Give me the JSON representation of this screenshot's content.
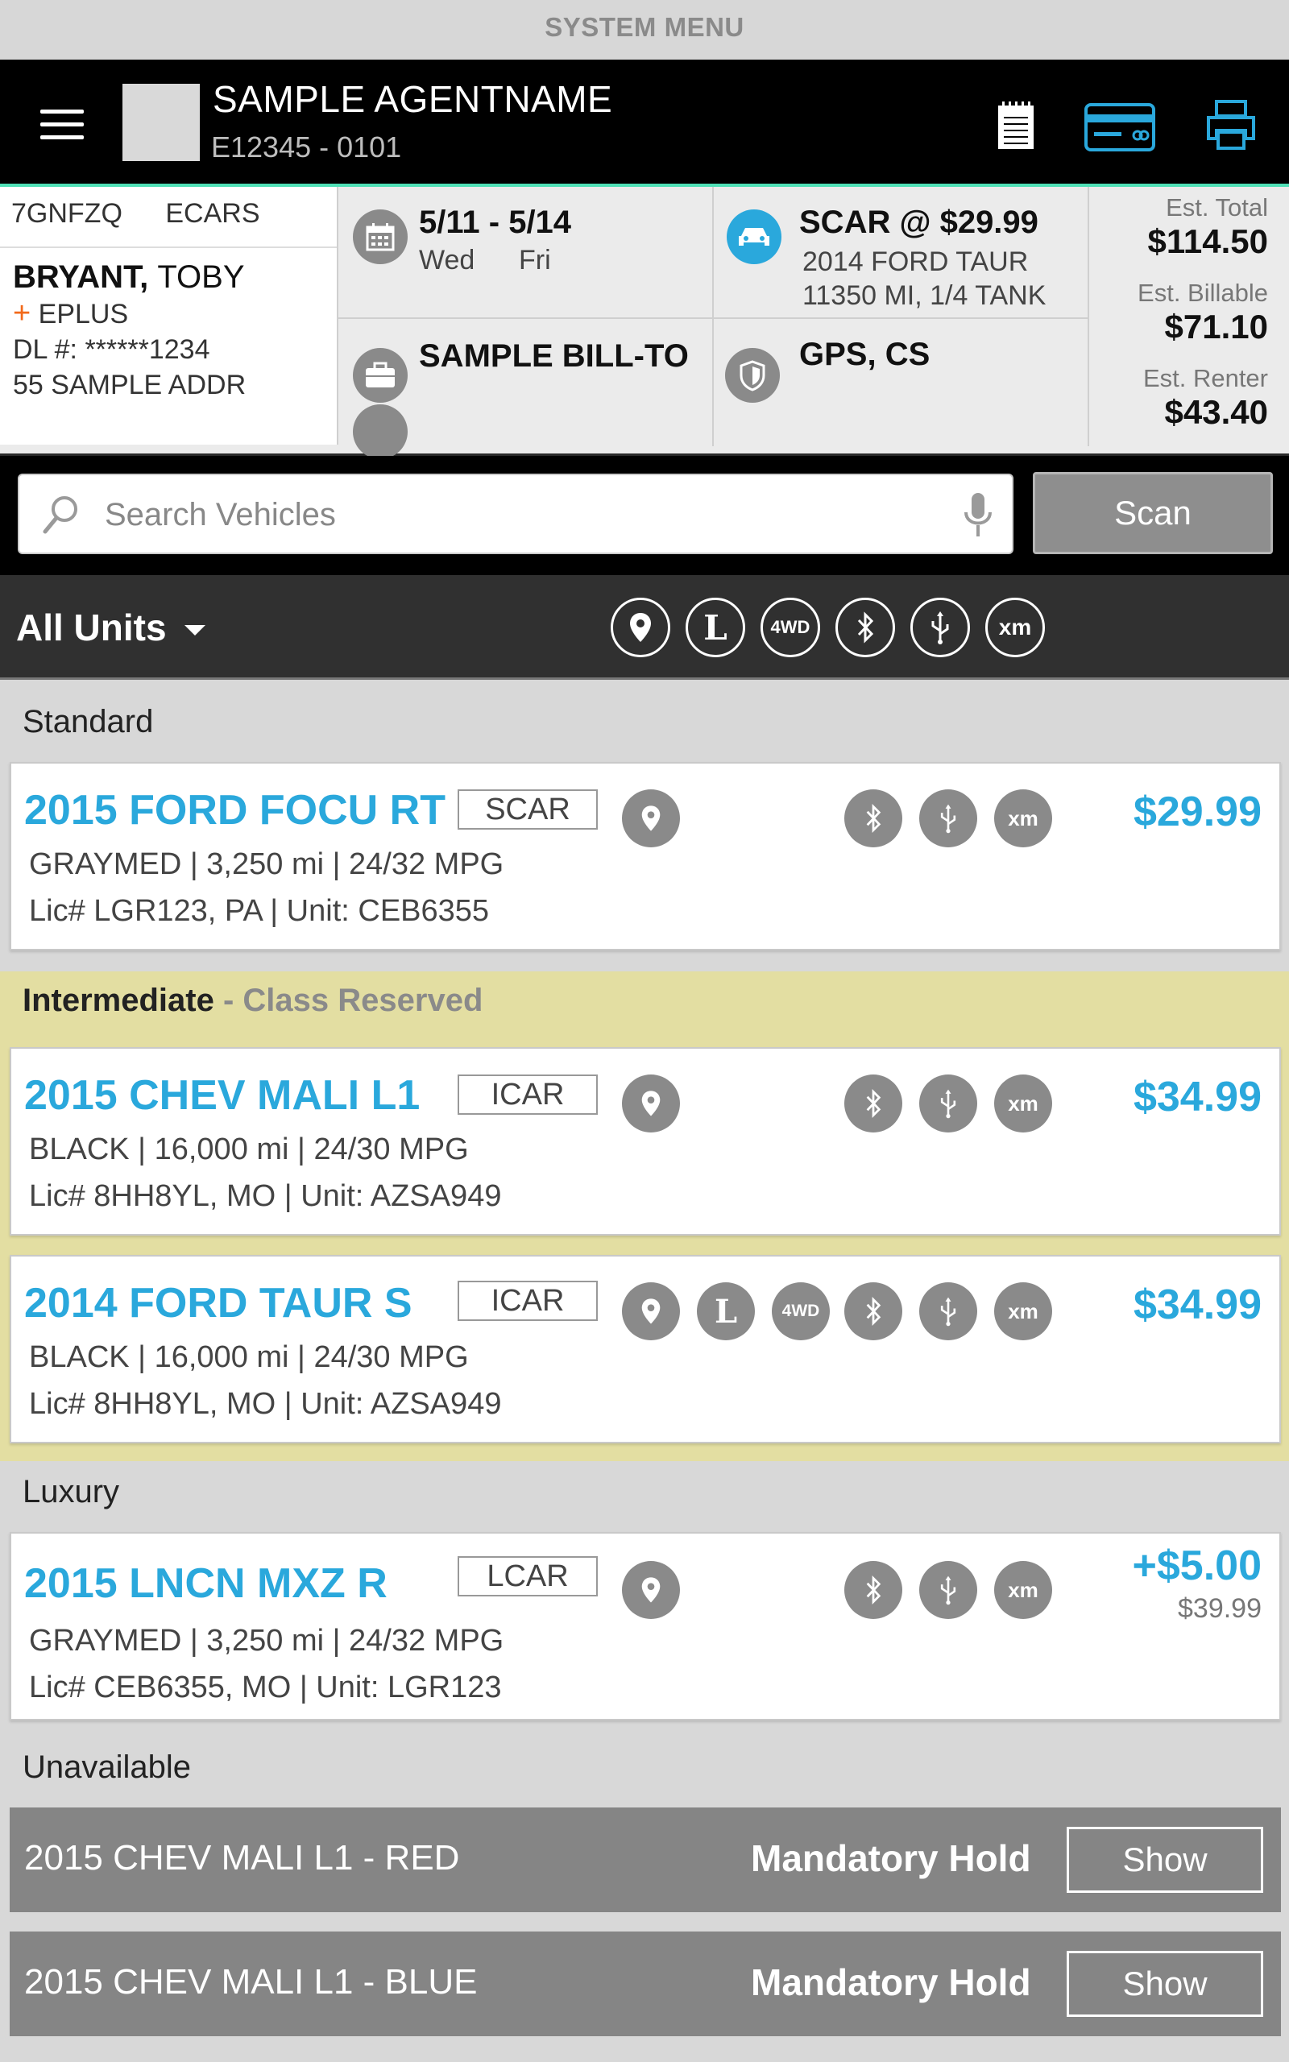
{
  "system_menu": "SYSTEM MENU",
  "agent": {
    "name": "SAMPLE AGENTNAME",
    "id": "E12345 - 0101"
  },
  "header_icons": [
    "notepad-icon",
    "credit-card-icon",
    "printer-icon"
  ],
  "customer": {
    "confirmation": "7GNFZQ",
    "source": "ECARS",
    "last_name": "BRYANT,",
    "first_name": "TOBY",
    "program_plus": "+",
    "program": "EPLUS",
    "dl": "DL #: ******1234",
    "address": "55 SAMPLE ADDR"
  },
  "reservation": {
    "dates": "5/11 - 5/14",
    "day_start": "Wed",
    "day_end": "Fri",
    "bill_to": "SAMPLE BILL-TO",
    "rate": "SCAR @ $29.99",
    "vehicle": "2014 FORD TAUR",
    "vehicle_status": "11350 MI, 1/4 TANK",
    "protections": "GPS, CS"
  },
  "totals": {
    "total_label": "Est. Total",
    "total_value": "$114.50",
    "billable_label": "Est. Billable",
    "billable_value": "$71.10",
    "renter_label": "Est. Renter",
    "renter_value": "$43.40"
  },
  "search": {
    "placeholder": "Search Vehicles",
    "scan_label": "Scan"
  },
  "filter": {
    "label": "All Units",
    "chips": [
      "location-pin-icon",
      "L",
      "4WD",
      "bluetooth-icon",
      "usb-icon",
      "xm"
    ]
  },
  "sections": {
    "standard": "Standard",
    "intermediate": "Intermediate",
    "intermediate_note": " - Class Reserved",
    "luxury": "Luxury",
    "unavailable": "Unavailable"
  },
  "vehicles": [
    {
      "title": "2015 FORD FOCU RT",
      "class": "SCAR",
      "line1": "GRAYMED | 3,250 mi | 24/32 MPG",
      "line2": "Lic# LGR123, PA | Unit: CEB6355",
      "price": "$29.99"
    },
    {
      "title": "2015 CHEV MALI L1",
      "class": "ICAR",
      "line1": "BLACK | 16,000 mi | 24/30 MPG",
      "line2": "Lic# 8HH8YL, MO | Unit: AZSA949",
      "price": "$34.99"
    },
    {
      "title": "2014 FORD TAUR S",
      "class": "ICAR",
      "line1": "BLACK | 16,000 mi | 24/30 MPG",
      "line2": "Lic# 8HH8YL, MO | Unit: AZSA949",
      "price": "$34.99"
    },
    {
      "title": "2015 LNCN MXZ R",
      "class": "LCAR",
      "line1": "GRAYMED | 3,250 mi | 24/32 MPG",
      "line2": "Lic# CEB6355, MO | Unit: LGR123",
      "price": "+$5.00",
      "subprice": "$39.99"
    }
  ],
  "unavailable": [
    {
      "name": "2015 CHEV MALI L1 - RED",
      "status": "Mandatory Hold",
      "button": "Show"
    },
    {
      "name": "2015 CHEV MALI L1 - BLUE",
      "status": "Mandatory Hold",
      "button": "Show"
    }
  ],
  "colors": {
    "accent": "#2aa8dc",
    "class_reserved_bg": "#e3dea2",
    "hold_bg": "#858585",
    "plus": "#f26a1b"
  }
}
